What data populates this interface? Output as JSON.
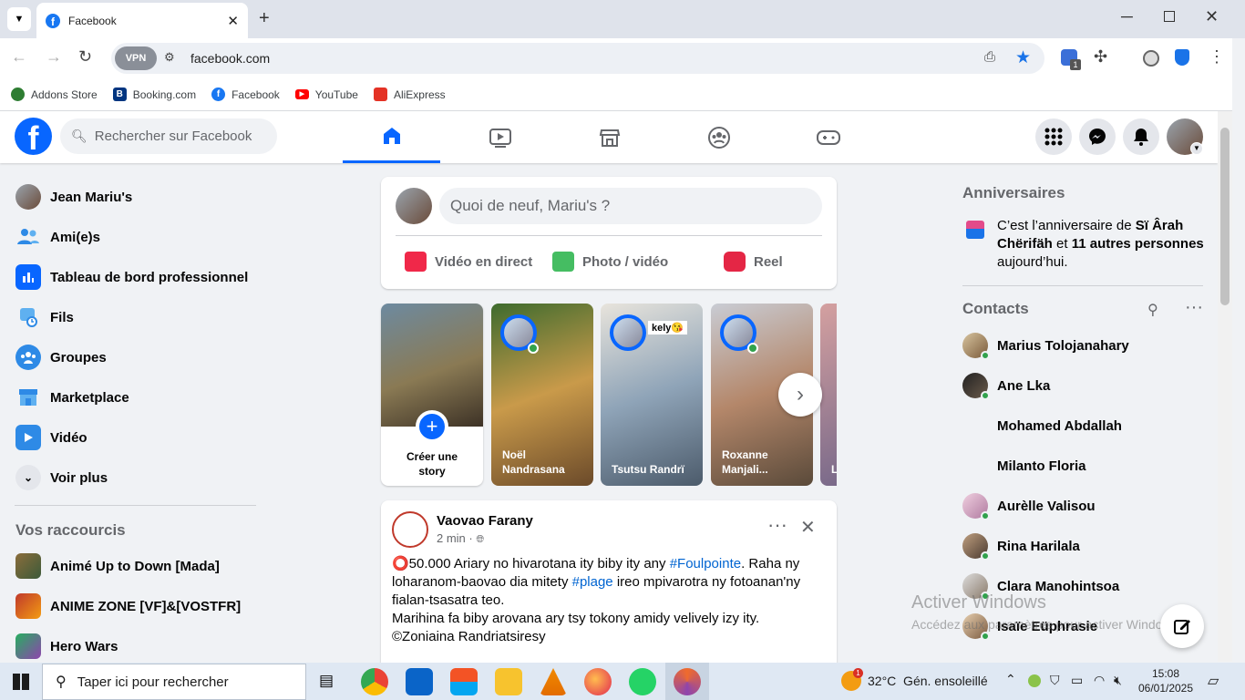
{
  "browser": {
    "tab_title": "Facebook",
    "url": "facebook.com",
    "vpn_label": "VPN",
    "ext_badge": "1",
    "bookmarks": [
      {
        "label": "Addons Store",
        "color": "#2e7d32"
      },
      {
        "label": "Booking.com",
        "color": "#003580"
      },
      {
        "label": "Facebook",
        "color": "#1877f2"
      },
      {
        "label": "YouTube",
        "color": "#ff0000"
      },
      {
        "label": "AliExpress",
        "color": "#e43225"
      }
    ]
  },
  "fb": {
    "logo": "f",
    "search_placeholder": "Rechercher sur Facebook",
    "brand_color": "#0866ff"
  },
  "left_nav": {
    "items": [
      {
        "label": "Jean Mariu's",
        "icon": "avatar"
      },
      {
        "label": "Ami(e)s",
        "icon": "friends-icon"
      },
      {
        "label": "Tableau de bord professionnel",
        "icon": "dashboard-icon"
      },
      {
        "label": "Fils",
        "icon": "feeds-icon"
      },
      {
        "label": "Groupes",
        "icon": "groups-icon"
      },
      {
        "label": "Marketplace",
        "icon": "marketplace-icon"
      },
      {
        "label": "Vidéo",
        "icon": "video-icon"
      },
      {
        "label": "Voir plus",
        "icon": "chevron-down-icon"
      }
    ],
    "shortcuts_title": "Vos raccourcis",
    "shortcuts": [
      {
        "label": "Animé Up to Down [Mada]"
      },
      {
        "label": "ANIME ZONE [VF]&[VOSTFR]"
      },
      {
        "label": "Hero Wars"
      }
    ]
  },
  "composer": {
    "placeholder": "Quoi de neuf, Mariu's ?",
    "live": "Vidéo en direct",
    "photo": "Photo / vidéo",
    "reel": "Reel"
  },
  "stories": [
    {
      "label": "Créer une story"
    },
    {
      "label": "Noël Nandrasana"
    },
    {
      "label": "Tsutsu Randrï"
    },
    {
      "label": "Roxanne Manjali..."
    },
    {
      "label": "L A"
    }
  ],
  "story_overlay_text": "kely😘",
  "post": {
    "author": "Vaovao Farany",
    "time": "2 min ·",
    "line1_pre": "⭕50.000 Ariary  no hivarotana ity biby ity any ",
    "hashtag1": "#Foulpointe",
    "line1_post": ". Raha ny",
    "line2_pre": "loharanom-baovao dia mitety ",
    "hashtag2": "#plage",
    "line2_post": " ireo mpivarotra ny fotoanan'ny",
    "line3": "fialan-tsasatra teo.",
    "line4": "Marihina fa biby arovana ary tsy tokony amidy velively izy ity.",
    "line5": "©Zoniaina Randriatsiresy"
  },
  "birthdays": {
    "title": "Anniversaires",
    "text_pre": "C’est l’anniversaire de ",
    "name": "Sï Ârah Chërifäh",
    "text_mid": " et ",
    "others": "11 autres personnes",
    "text_post": " aujourd’hui."
  },
  "contacts": {
    "title": "Contacts",
    "items": [
      {
        "name": "Marius Tolojanahary",
        "online": true
      },
      {
        "name": "Ane Lka",
        "online": true
      },
      {
        "name": "Mohamed Abdallah",
        "online": false
      },
      {
        "name": "Milanto Floria",
        "online": false
      },
      {
        "name": "Aurèlle Valisou",
        "online": true
      },
      {
        "name": "Rina Harilala",
        "online": true
      },
      {
        "name": "Clara Manohintsoa",
        "online": true
      },
      {
        "name": "Isaïe Eüphrasie",
        "online": true
      }
    ]
  },
  "watermark": {
    "title": "Activer Windows",
    "subtitle": "Accédez aux paramètres pour activer Windows."
  },
  "taskbar": {
    "search_placeholder": "Taper ici pour rechercher",
    "weather": "32°C  Gén. ensoleillé",
    "weather_badge": "1",
    "time": "15:08",
    "date": "06/01/2025"
  }
}
